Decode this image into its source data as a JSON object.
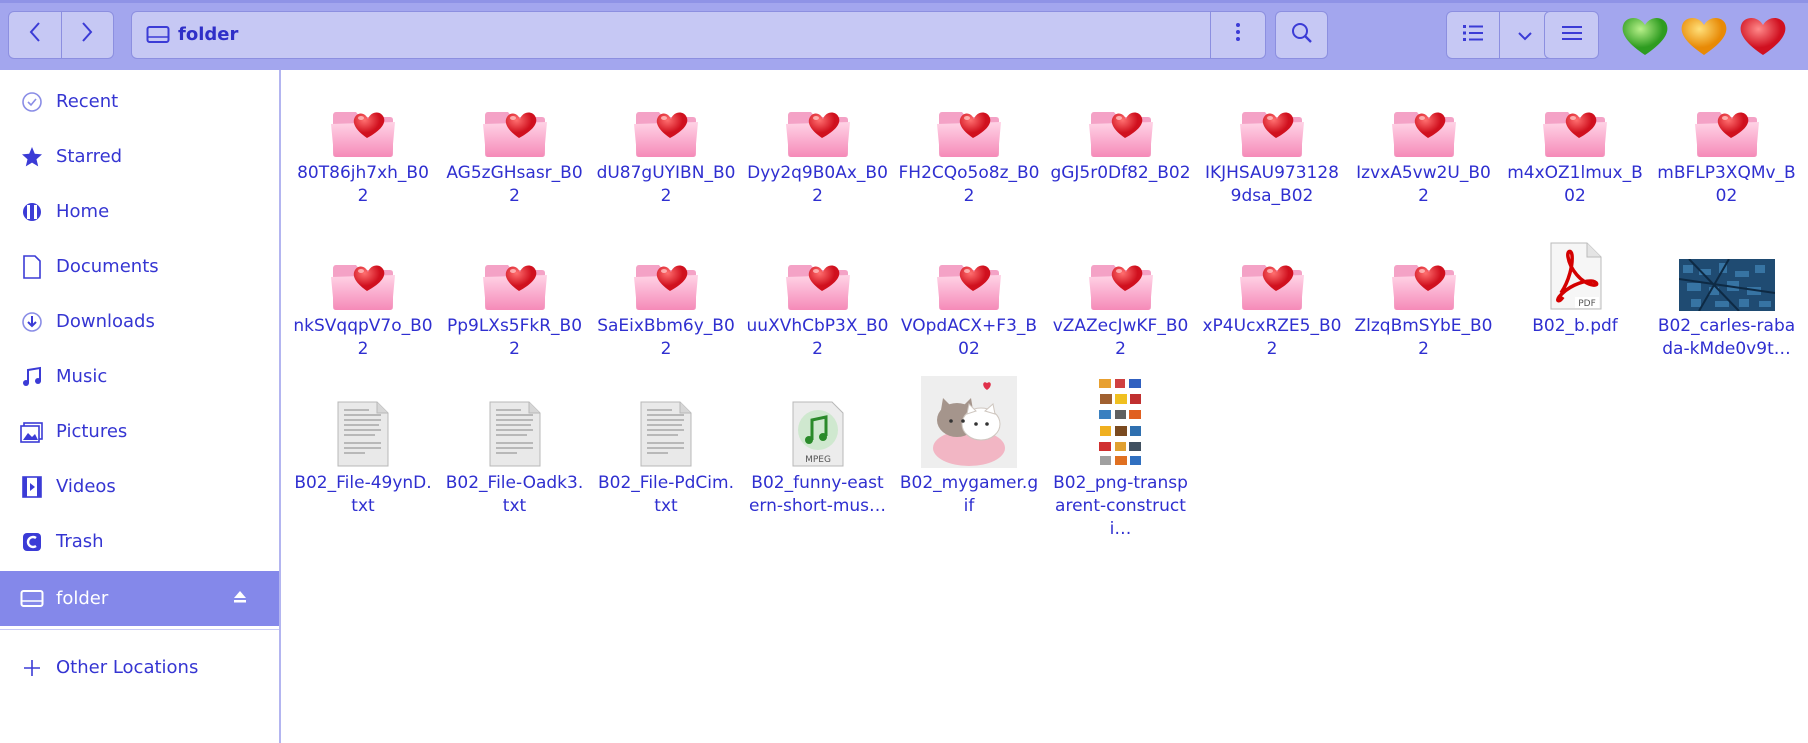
{
  "header": {
    "back_icon": "chevron-left-icon",
    "forward_icon": "chevron-right-icon",
    "path_crumb": "folder",
    "path_menu_icon": "vertical-dots-icon",
    "search_icon": "search-icon",
    "view_list_icon": "list-view-icon",
    "view_options_icon": "chevron-down-icon",
    "main_menu_icon": "hamburger-icon",
    "window_buttons": [
      {
        "name": "minimize",
        "color": "#3cb02a"
      },
      {
        "name": "maximize",
        "color": "#f0a010"
      },
      {
        "name": "close",
        "color": "#e0242c"
      }
    ]
  },
  "sidebar": {
    "items": [
      {
        "label": "Recent",
        "icon": "clock-icon"
      },
      {
        "label": "Starred",
        "icon": "star-icon"
      },
      {
        "label": "Home",
        "icon": "home-icon"
      },
      {
        "label": "Documents",
        "icon": "document-icon"
      },
      {
        "label": "Downloads",
        "icon": "download-icon"
      },
      {
        "label": "Music",
        "icon": "music-icon"
      },
      {
        "label": "Pictures",
        "icon": "pictures-icon"
      },
      {
        "label": "Videos",
        "icon": "videos-icon"
      },
      {
        "label": "Trash",
        "icon": "trash-icon"
      },
      {
        "label": "folder",
        "icon": "drive-icon",
        "active": true
      },
      {
        "label": "Other Locations",
        "icon": "plus-icon"
      }
    ]
  },
  "files": [
    {
      "name": "80T86jh7xh_B02",
      "type": "folder"
    },
    {
      "name": "AG5zGHsasr_B02",
      "type": "folder"
    },
    {
      "name": "dU87gUYIBN_B02",
      "type": "folder"
    },
    {
      "name": "Dyy2q9B0Ax_B02",
      "type": "folder"
    },
    {
      "name": "FH2CQo5o8z_B02",
      "type": "folder"
    },
    {
      "name": "gGJ5r0Df82_B02",
      "type": "folder"
    },
    {
      "name": "IKJHSAU9731289dsa_B02",
      "type": "folder"
    },
    {
      "name": "IzvxA5vw2U_B02",
      "type": "folder"
    },
    {
      "name": "m4xOZ1lmux_B02",
      "type": "folder"
    },
    {
      "name": "mBFLP3XQMv_B02",
      "type": "folder"
    },
    {
      "name": "nkSVqqpV7o_B02",
      "type": "folder"
    },
    {
      "name": "Pp9LXs5FkR_B02",
      "type": "folder"
    },
    {
      "name": "SaEixBbm6y_B02",
      "type": "folder"
    },
    {
      "name": "uuXVhCbP3X_B02",
      "type": "folder"
    },
    {
      "name": "VOpdACX+F3_B02",
      "type": "folder"
    },
    {
      "name": "vZAZecJwKF_B02",
      "type": "folder"
    },
    {
      "name": "xP4UcxRZE5_B02",
      "type": "folder"
    },
    {
      "name": "ZlzqBmSYbE_B02",
      "type": "folder"
    },
    {
      "name": "B02_b.pdf",
      "type": "pdf"
    },
    {
      "name": "B02_carles-rabada-kMde0v9t…",
      "type": "image-blue"
    },
    {
      "name": "B02_File-49ynD.txt",
      "type": "text"
    },
    {
      "name": "B02_File-Oadk3.txt",
      "type": "text"
    },
    {
      "name": "B02_File-PdCim.txt",
      "type": "text"
    },
    {
      "name": "B02_funny-eastern-short-mus…",
      "type": "audio"
    },
    {
      "name": "B02_mygamer.gif",
      "type": "image-cats"
    },
    {
      "name": "B02_png-transparent-constructi…",
      "type": "image-tools"
    }
  ]
}
